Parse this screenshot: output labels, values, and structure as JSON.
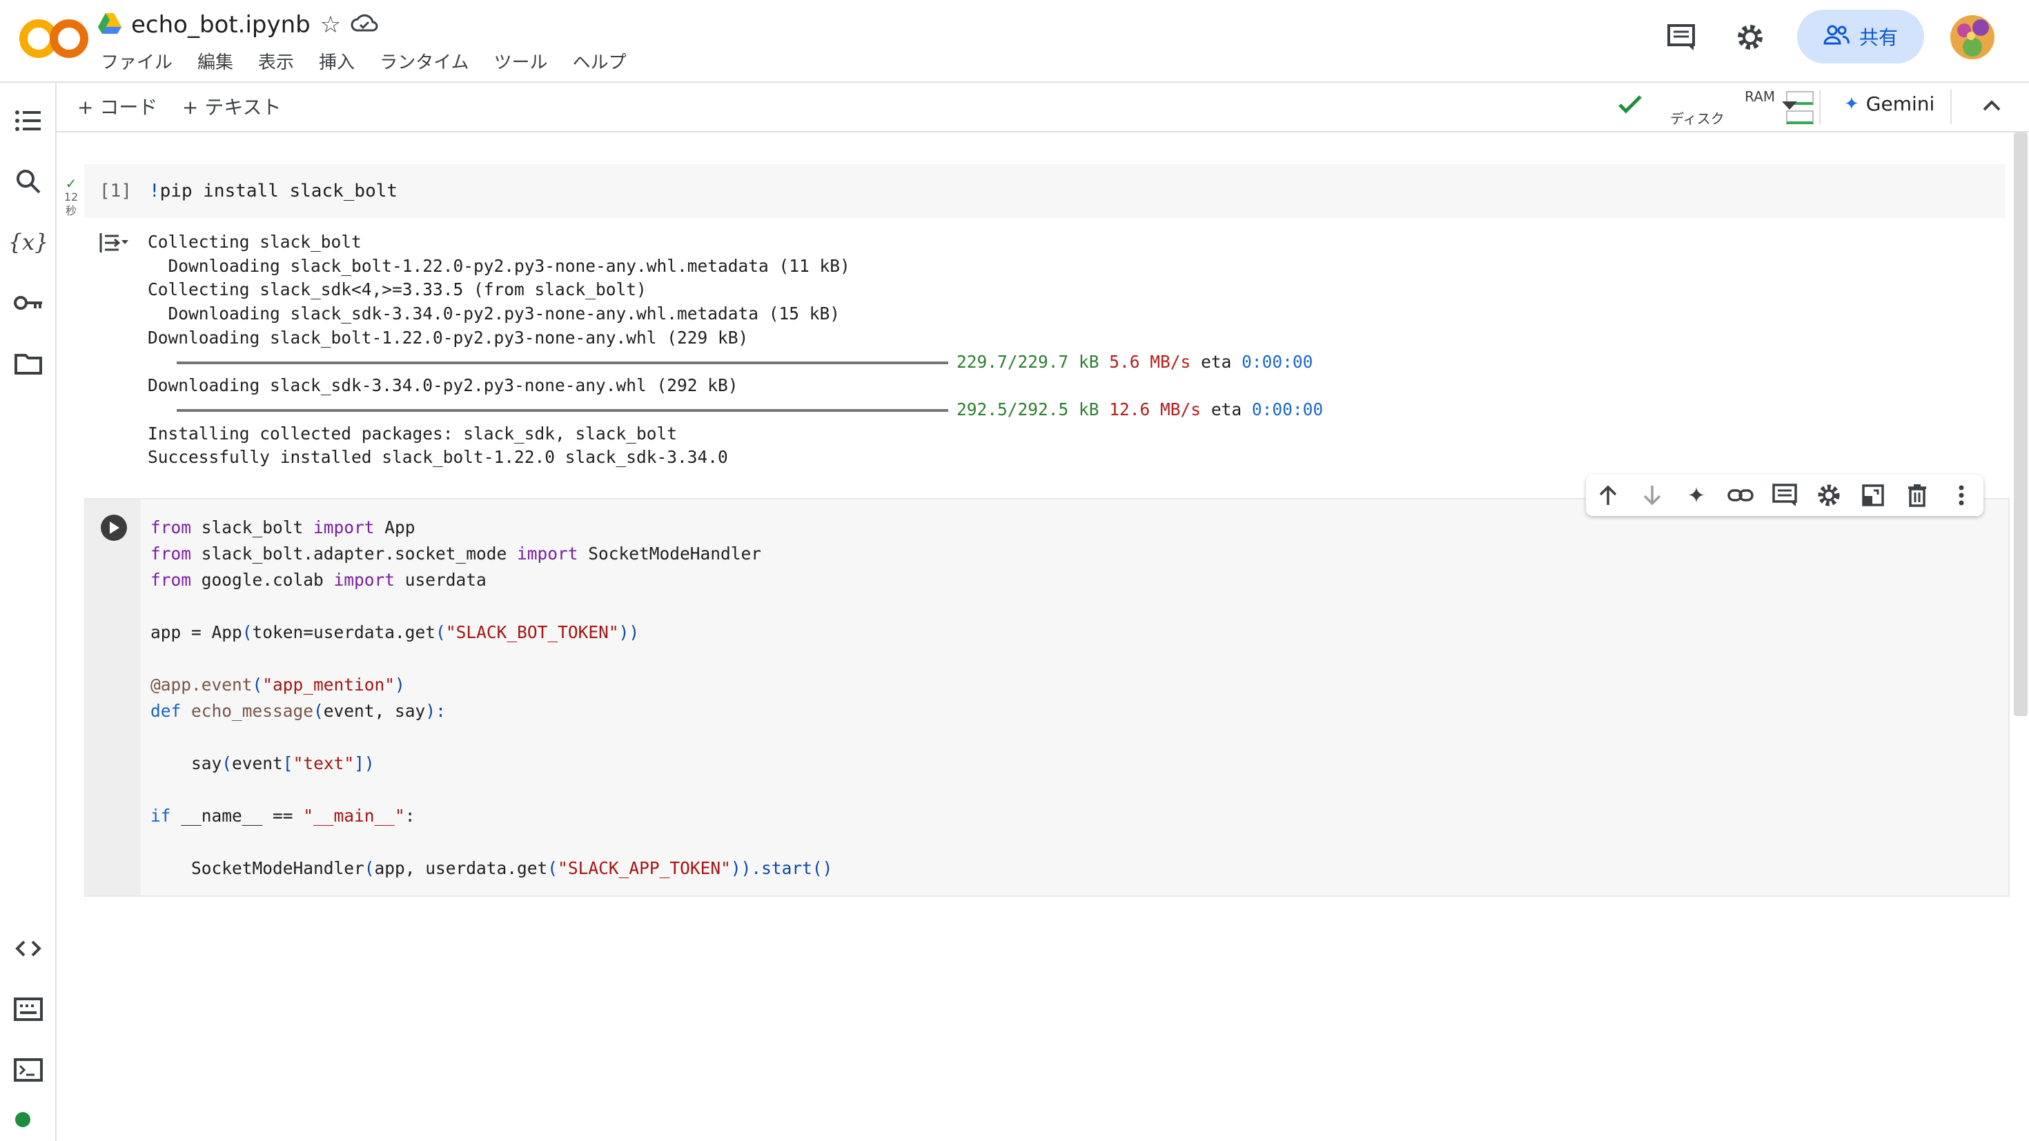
{
  "app": {
    "doc_title": "echo_bot.ipynb",
    "menu": [
      "ファイル",
      "編集",
      "表示",
      "挿入",
      "ランタイム",
      "ツール",
      "ヘルプ"
    ],
    "share_label": "共有"
  },
  "toolbar": {
    "add_code": "+ コード",
    "add_text": "+ テキスト",
    "ram_label": "RAM",
    "disk_label": "ディスク",
    "gemini_label": "Gemini"
  },
  "cell1": {
    "exec_count": "[1]",
    "code": "!pip install slack_bolt",
    "duration_value": "12",
    "duration_unit": "秒",
    "output": {
      "line1": "Collecting slack_bolt",
      "line2": "  Downloading slack_bolt-1.22.0-py2.py3-none-any.whl.metadata (11 kB)",
      "line3": "Collecting slack_sdk<4,>=3.33.5 (from slack_bolt)",
      "line4": "  Downloading slack_sdk-3.34.0-py2.py3-none-any.whl.metadata (15 kB)",
      "line5": "Downloading slack_bolt-1.22.0-py2.py3-none-any.whl (229 kB)",
      "progress1": {
        "size": "229.7/229.7 kB",
        "speed": "5.6 MB/s",
        "eta_label": "eta",
        "eta": "0:00:00",
        "fraction": 1.0
      },
      "line6": "Downloading slack_sdk-3.34.0-py2.py3-none-any.whl (292 kB)",
      "progress2": {
        "size": "292.5/292.5 kB",
        "speed": "12.6 MB/s",
        "eta_label": "eta",
        "eta": "0:00:00",
        "fraction": 1.0
      },
      "line7": "Installing collected packages: slack_sdk, slack_bolt",
      "line8": "Successfully installed slack_bolt-1.22.0 slack_sdk-3.34.0"
    }
  },
  "cell2": {
    "l1": {
      "a": "from",
      "b": " slack_bolt ",
      "c": "import",
      "d": " App"
    },
    "l2": {
      "a": "from",
      "b": " slack_bolt.adapter.socket_mode ",
      "c": "import",
      "d": " SocketModeHandler"
    },
    "l3": {
      "a": "from",
      "b": " google.colab ",
      "c": "import",
      "d": " userdata"
    },
    "l4": {
      "a": "app = App",
      "b": "(",
      "c": "token=userdata.get",
      "d": "(",
      "e": "\"SLACK_BOT_TOKEN\"",
      "f": "))"
    },
    "l5": {
      "a": "@app.event",
      "b": "(",
      "c": "\"app_mention\"",
      "d": ")"
    },
    "l6": {
      "a": "def",
      "b": " echo_message",
      "c": "(",
      "d": "event, say",
      "e": "):"
    },
    "l7": {
      "a": "    say",
      "b": "(",
      "c": "event",
      "d": "[",
      "e": "\"text\"",
      "f": "])"
    },
    "l8": {
      "a": "if",
      "b": " __name__ == ",
      "c": "\"__main__\"",
      "d": ":"
    },
    "l9": {
      "a": "    SocketModeHandler",
      "b": "(",
      "c": "app, userdata.get",
      "d": "(",
      "e": "\"SLACK_APP_TOKEN\"",
      "f": ")).start()"
    }
  },
  "colors": {
    "accent": "#0b57d0",
    "share_bg": "#d3e3fd",
    "logo_orange": "#f9ab00",
    "logo_dark": "#e8710a"
  }
}
